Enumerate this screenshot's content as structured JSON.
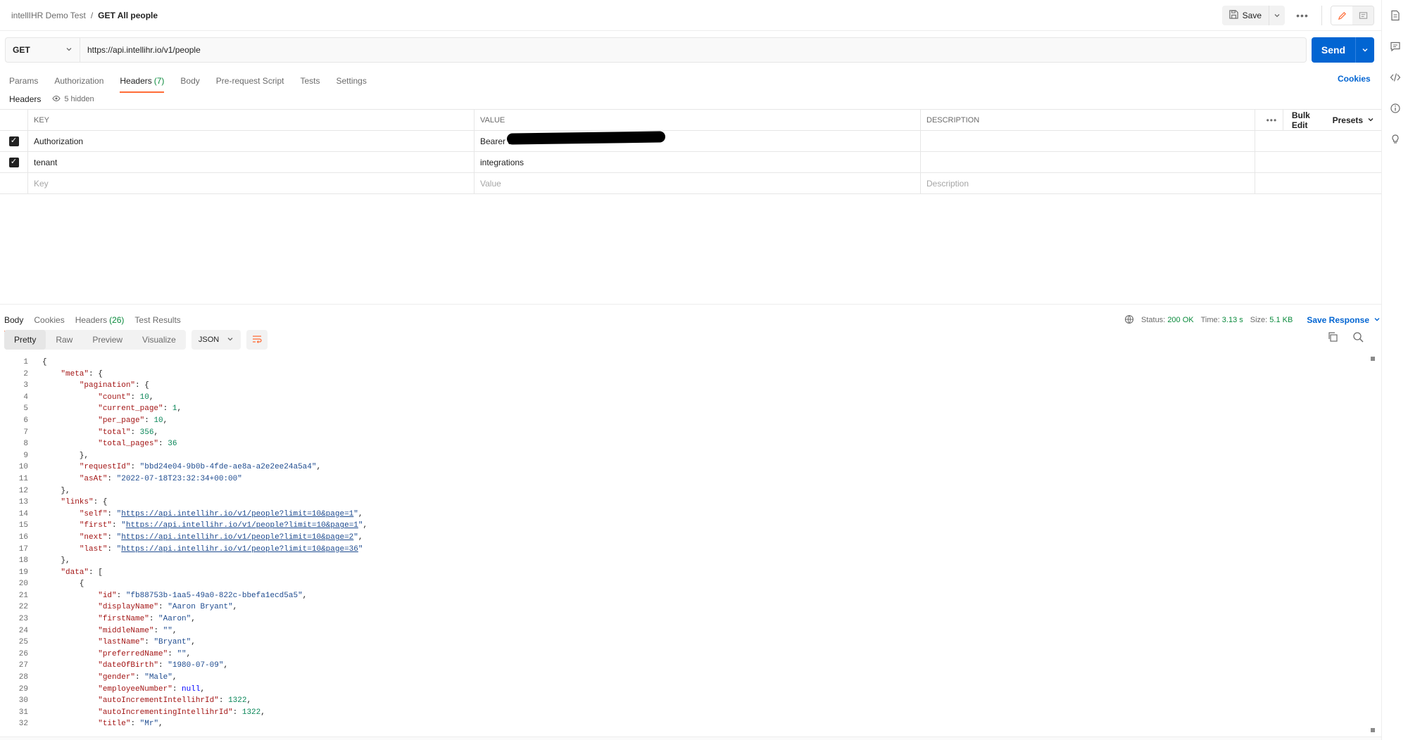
{
  "breadcrumb": {
    "parent": "intellIHR Demo Test",
    "separator": "/",
    "current": "GET All people"
  },
  "toolbar": {
    "save_label": "Save",
    "more_label": "•••"
  },
  "request": {
    "method": "GET",
    "url": "https://api.intellihr.io/v1/people",
    "send_label": "Send",
    "tabs": [
      {
        "label": "Params"
      },
      {
        "label": "Authorization"
      },
      {
        "label": "Headers",
        "count": "(7)"
      },
      {
        "label": "Body"
      },
      {
        "label": "Pre-request Script"
      },
      {
        "label": "Tests"
      },
      {
        "label": "Settings"
      }
    ],
    "cookies_label": "Cookies",
    "headers_label": "Headers",
    "hidden_label": "5 hidden"
  },
  "headers_table": {
    "columns": {
      "key": "KEY",
      "value": "VALUE",
      "description": "DESCRIPTION"
    },
    "more_label": "•••",
    "bulk_edit": "Bulk Edit",
    "presets": "Presets",
    "rows": [
      {
        "key": "Authorization",
        "value": "Bearer d",
        "description": ""
      },
      {
        "key": "tenant",
        "value": "integrations",
        "description": ""
      }
    ],
    "placeholder": {
      "key": "Key",
      "value": "Value",
      "description": "Description"
    }
  },
  "response": {
    "tabs": [
      {
        "label": "Body"
      },
      {
        "label": "Cookies"
      },
      {
        "label": "Headers",
        "count": "(26)"
      },
      {
        "label": "Test Results"
      }
    ],
    "status_label": "Status:",
    "status_value": "200 OK",
    "time_label": "Time:",
    "time_value": "3.13 s",
    "size_label": "Size:",
    "size_value": "5.1 KB",
    "save_response": "Save Response",
    "formats": [
      "Pretty",
      "Raw",
      "Preview",
      "Visualize"
    ],
    "language": "JSON"
  },
  "accent_colors": {
    "send": "#0265d2",
    "active_tab": "#ff6c37",
    "status_ok": "#0a8a3c"
  },
  "code_lines": [
    [
      [
        "p",
        "{"
      ]
    ],
    [
      [
        "p",
        "    "
      ],
      [
        "k",
        "\"meta\""
      ],
      [
        "p",
        ": {"
      ]
    ],
    [
      [
        "p",
        "        "
      ],
      [
        "k",
        "\"pagination\""
      ],
      [
        "p",
        ": {"
      ]
    ],
    [
      [
        "p",
        "            "
      ],
      [
        "k",
        "\"count\""
      ],
      [
        "p",
        ": "
      ],
      [
        "n",
        "10"
      ],
      [
        "p",
        ","
      ]
    ],
    [
      [
        "p",
        "            "
      ],
      [
        "k",
        "\"current_page\""
      ],
      [
        "p",
        ": "
      ],
      [
        "n",
        "1"
      ],
      [
        "p",
        ","
      ]
    ],
    [
      [
        "p",
        "            "
      ],
      [
        "k",
        "\"per_page\""
      ],
      [
        "p",
        ": "
      ],
      [
        "n",
        "10"
      ],
      [
        "p",
        ","
      ]
    ],
    [
      [
        "p",
        "            "
      ],
      [
        "k",
        "\"total\""
      ],
      [
        "p",
        ": "
      ],
      [
        "n",
        "356"
      ],
      [
        "p",
        ","
      ]
    ],
    [
      [
        "p",
        "            "
      ],
      [
        "k",
        "\"total_pages\""
      ],
      [
        "p",
        ": "
      ],
      [
        "n",
        "36"
      ]
    ],
    [
      [
        "p",
        "        },"
      ]
    ],
    [
      [
        "p",
        "        "
      ],
      [
        "k",
        "\"requestId\""
      ],
      [
        "p",
        ": "
      ],
      [
        "s",
        "\"bbd24e04-9b0b-4fde-ae8a-a2e2ee24a5a4\""
      ],
      [
        "p",
        ","
      ]
    ],
    [
      [
        "p",
        "        "
      ],
      [
        "k",
        "\"asAt\""
      ],
      [
        "p",
        ": "
      ],
      [
        "s",
        "\"2022-07-18T23:32:34+00:00\""
      ]
    ],
    [
      [
        "p",
        "    },"
      ]
    ],
    [
      [
        "p",
        "    "
      ],
      [
        "k",
        "\"links\""
      ],
      [
        "p",
        ": {"
      ]
    ],
    [
      [
        "p",
        "        "
      ],
      [
        "k",
        "\"self\""
      ],
      [
        "p",
        ": "
      ],
      [
        "s",
        "\""
      ],
      [
        "l",
        "https://api.intellihr.io/v1/people?limit=10&page=1"
      ],
      [
        "s",
        "\""
      ],
      [
        "p",
        ","
      ]
    ],
    [
      [
        "p",
        "        "
      ],
      [
        "k",
        "\"first\""
      ],
      [
        "p",
        ": "
      ],
      [
        "s",
        "\""
      ],
      [
        "l",
        "https://api.intellihr.io/v1/people?limit=10&page=1"
      ],
      [
        "s",
        "\""
      ],
      [
        "p",
        ","
      ]
    ],
    [
      [
        "p",
        "        "
      ],
      [
        "k",
        "\"next\""
      ],
      [
        "p",
        ": "
      ],
      [
        "s",
        "\""
      ],
      [
        "l",
        "https://api.intellihr.io/v1/people?limit=10&page=2"
      ],
      [
        "s",
        "\""
      ],
      [
        "p",
        ","
      ]
    ],
    [
      [
        "p",
        "        "
      ],
      [
        "k",
        "\"last\""
      ],
      [
        "p",
        ": "
      ],
      [
        "s",
        "\""
      ],
      [
        "l",
        "https://api.intellihr.io/v1/people?limit=10&page=36"
      ],
      [
        "s",
        "\""
      ]
    ],
    [
      [
        "p",
        "    },"
      ]
    ],
    [
      [
        "p",
        "    "
      ],
      [
        "k",
        "\"data\""
      ],
      [
        "p",
        ": ["
      ]
    ],
    [
      [
        "p",
        "        {"
      ]
    ],
    [
      [
        "p",
        "            "
      ],
      [
        "k",
        "\"id\""
      ],
      [
        "p",
        ": "
      ],
      [
        "s",
        "\"fb88753b-1aa5-49a0-822c-bbefa1ecd5a5\""
      ],
      [
        "p",
        ","
      ]
    ],
    [
      [
        "p",
        "            "
      ],
      [
        "k",
        "\"displayName\""
      ],
      [
        "p",
        ": "
      ],
      [
        "s",
        "\"Aaron Bryant\""
      ],
      [
        "p",
        ","
      ]
    ],
    [
      [
        "p",
        "            "
      ],
      [
        "k",
        "\"firstName\""
      ],
      [
        "p",
        ": "
      ],
      [
        "s",
        "\"Aaron\""
      ],
      [
        "p",
        ","
      ]
    ],
    [
      [
        "p",
        "            "
      ],
      [
        "k",
        "\"middleName\""
      ],
      [
        "p",
        ": "
      ],
      [
        "s",
        "\"\""
      ],
      [
        "p",
        ","
      ]
    ],
    [
      [
        "p",
        "            "
      ],
      [
        "k",
        "\"lastName\""
      ],
      [
        "p",
        ": "
      ],
      [
        "s",
        "\"Bryant\""
      ],
      [
        "p",
        ","
      ]
    ],
    [
      [
        "p",
        "            "
      ],
      [
        "k",
        "\"preferredName\""
      ],
      [
        "p",
        ": "
      ],
      [
        "s",
        "\"\""
      ],
      [
        "p",
        ","
      ]
    ],
    [
      [
        "p",
        "            "
      ],
      [
        "k",
        "\"dateOfBirth\""
      ],
      [
        "p",
        ": "
      ],
      [
        "s",
        "\"1980-07-09\""
      ],
      [
        "p",
        ","
      ]
    ],
    [
      [
        "p",
        "            "
      ],
      [
        "k",
        "\"gender\""
      ],
      [
        "p",
        ": "
      ],
      [
        "s",
        "\"Male\""
      ],
      [
        "p",
        ","
      ]
    ],
    [
      [
        "p",
        "            "
      ],
      [
        "k",
        "\"employeeNumber\""
      ],
      [
        "p",
        ": "
      ],
      [
        "w",
        "null"
      ],
      [
        "p",
        ","
      ]
    ],
    [
      [
        "p",
        "            "
      ],
      [
        "k",
        "\"autoIncrementIntellihrId\""
      ],
      [
        "p",
        ": "
      ],
      [
        "n",
        "1322"
      ],
      [
        "p",
        ","
      ]
    ],
    [
      [
        "p",
        "            "
      ],
      [
        "k",
        "\"autoIncrementingIntellihrId\""
      ],
      [
        "p",
        ": "
      ],
      [
        "n",
        "1322"
      ],
      [
        "p",
        ","
      ]
    ],
    [
      [
        "p",
        "            "
      ],
      [
        "k",
        "\"title\""
      ],
      [
        "p",
        ": "
      ],
      [
        "s",
        "\"Mr\""
      ],
      [
        "p",
        ","
      ]
    ]
  ]
}
